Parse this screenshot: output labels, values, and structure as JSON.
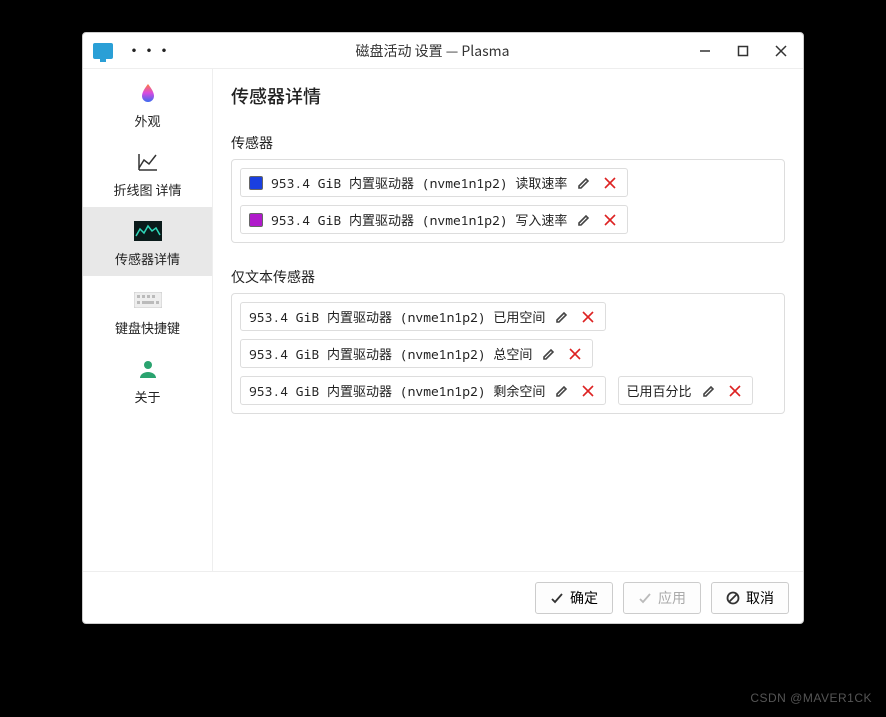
{
  "window": {
    "title": "磁盘活动 设置 — Plasma"
  },
  "sidebar": {
    "items": [
      {
        "label": "外观"
      },
      {
        "label": "折线图 详情"
      },
      {
        "label": "传感器详情"
      },
      {
        "label": "键盘快捷键"
      },
      {
        "label": "关于"
      }
    ]
  },
  "page": {
    "heading": "传感器详情",
    "sensors_label": "传感器",
    "text_sensors_label": "仅文本传感器"
  },
  "sensors": [
    {
      "color": "#1a3fe0",
      "text": "953.4 GiB 内置驱动器 (nvme1n1p2) 读取速率"
    },
    {
      "color": "#b01acb",
      "text": "953.4 GiB 内置驱动器 (nvme1n1p2) 写入速率"
    }
  ],
  "text_sensors_row1": [
    {
      "text": "953.4 GiB 内置驱动器 (nvme1n1p2) 已用空间"
    }
  ],
  "text_sensors_row2": [
    {
      "text": "953.4 GiB 内置驱动器 (nvme1n1p2) 总空间"
    }
  ],
  "text_sensors_row3": [
    {
      "text": "953.4 GiB 内置驱动器 (nvme1n1p2) 剩余空间"
    },
    {
      "text": "已用百分比"
    }
  ],
  "footer": {
    "ok": "确定",
    "apply": "应用",
    "cancel": "取消"
  },
  "watermark": "CSDN @MAVER1CK"
}
